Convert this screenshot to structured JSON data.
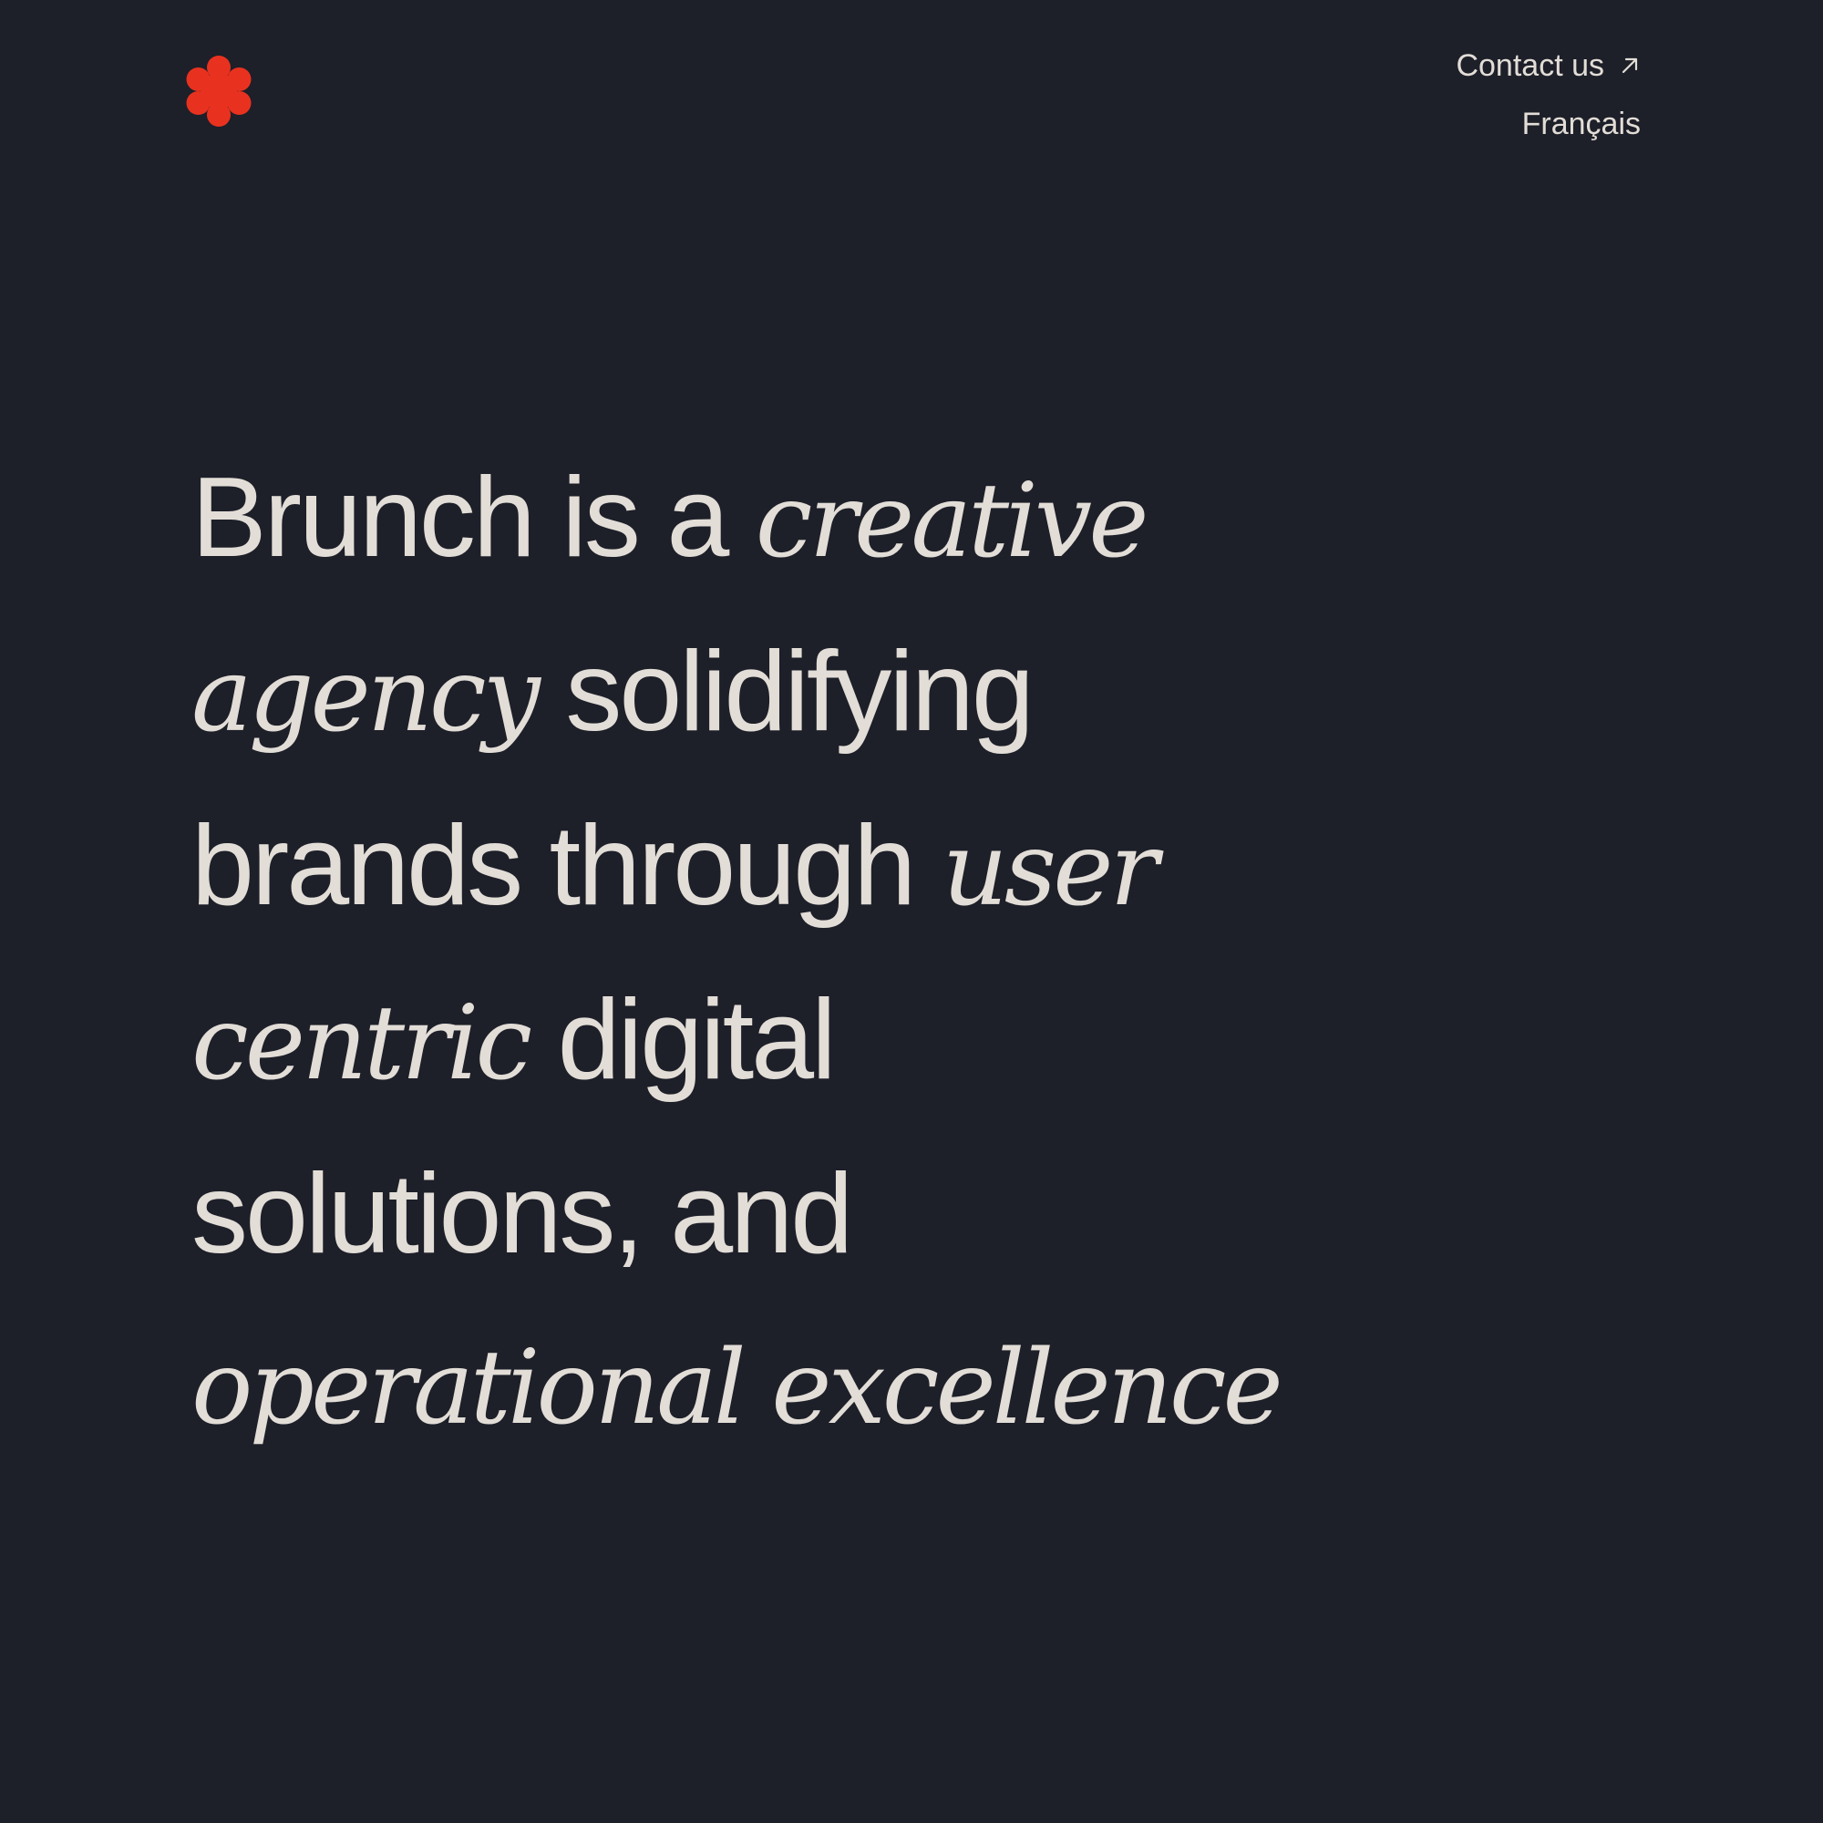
{
  "brand": {
    "logo_icon": "flower-asterisk-icon",
    "logo_color": "#e8321f"
  },
  "nav": {
    "contact_label": "Contact us",
    "contact_icon": "arrow-up-right-icon",
    "language_label": "Français"
  },
  "hero": {
    "lines": [
      [
        {
          "text": "Brunch is a ",
          "italic": false
        },
        {
          "text": "creative",
          "italic": true
        }
      ],
      [
        {
          "text": "agency",
          "italic": true
        },
        {
          "text": " solidifying",
          "italic": false
        }
      ],
      [
        {
          "text": "brands through ",
          "italic": false
        },
        {
          "text": "user",
          "italic": true
        }
      ],
      [
        {
          "text": "centric",
          "italic": true
        },
        {
          "text": " digital",
          "italic": false
        }
      ],
      [
        {
          "text": "solutions, and",
          "italic": false
        }
      ],
      [
        {
          "text": "operational excellence",
          "italic": true
        }
      ]
    ]
  },
  "colors": {
    "background": "#1d1f29",
    "text": "#e2ddd6",
    "accent": "#e8321f"
  }
}
